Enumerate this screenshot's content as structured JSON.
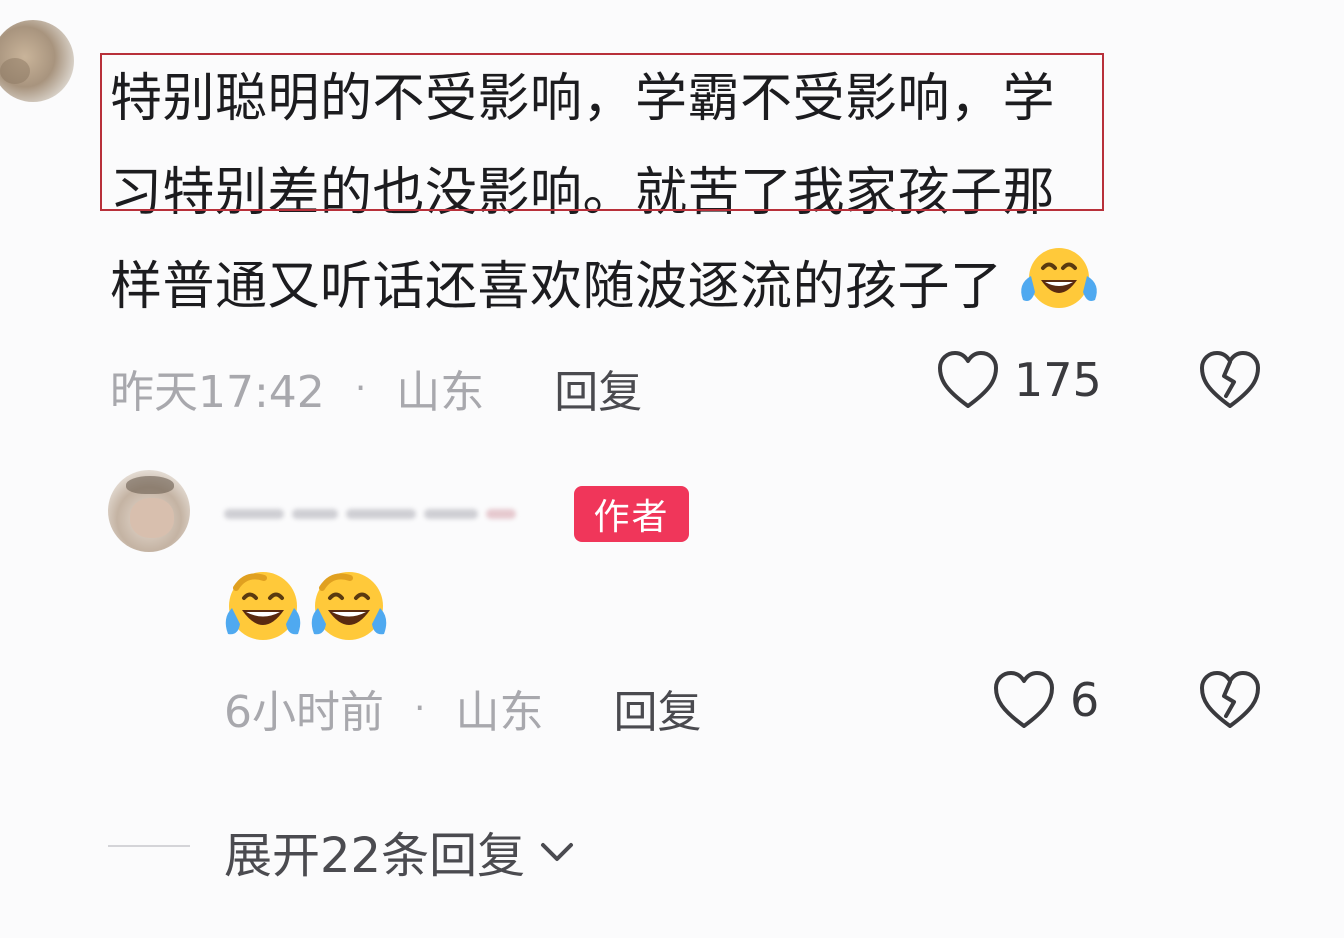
{
  "comment": {
    "text_line1": "特别聪明的不受影响，学霸不受影响，学",
    "text_line2": "习特别差的也没影响。就苦了我家孩子那",
    "text_line3": "样普通又听话还喜欢随波逐流的孩子了",
    "emoji": "laughing-crying-emoji",
    "time": "昨天17:42",
    "separator": "·",
    "location": "山东",
    "reply_label": "回复",
    "likes": "175"
  },
  "reply": {
    "author_badge": "作者",
    "emojis": [
      "laughing-crying-emoji",
      "laughing-crying-emoji"
    ],
    "time": "6小时前",
    "separator": "·",
    "location": "山东",
    "reply_label": "回复",
    "likes": "6"
  },
  "expand": {
    "label": "展开22条回复"
  },
  "colors": {
    "highlight_box": "#b8303a",
    "author_badge": "#f0365a",
    "meta_text": "#a8a8ad"
  }
}
